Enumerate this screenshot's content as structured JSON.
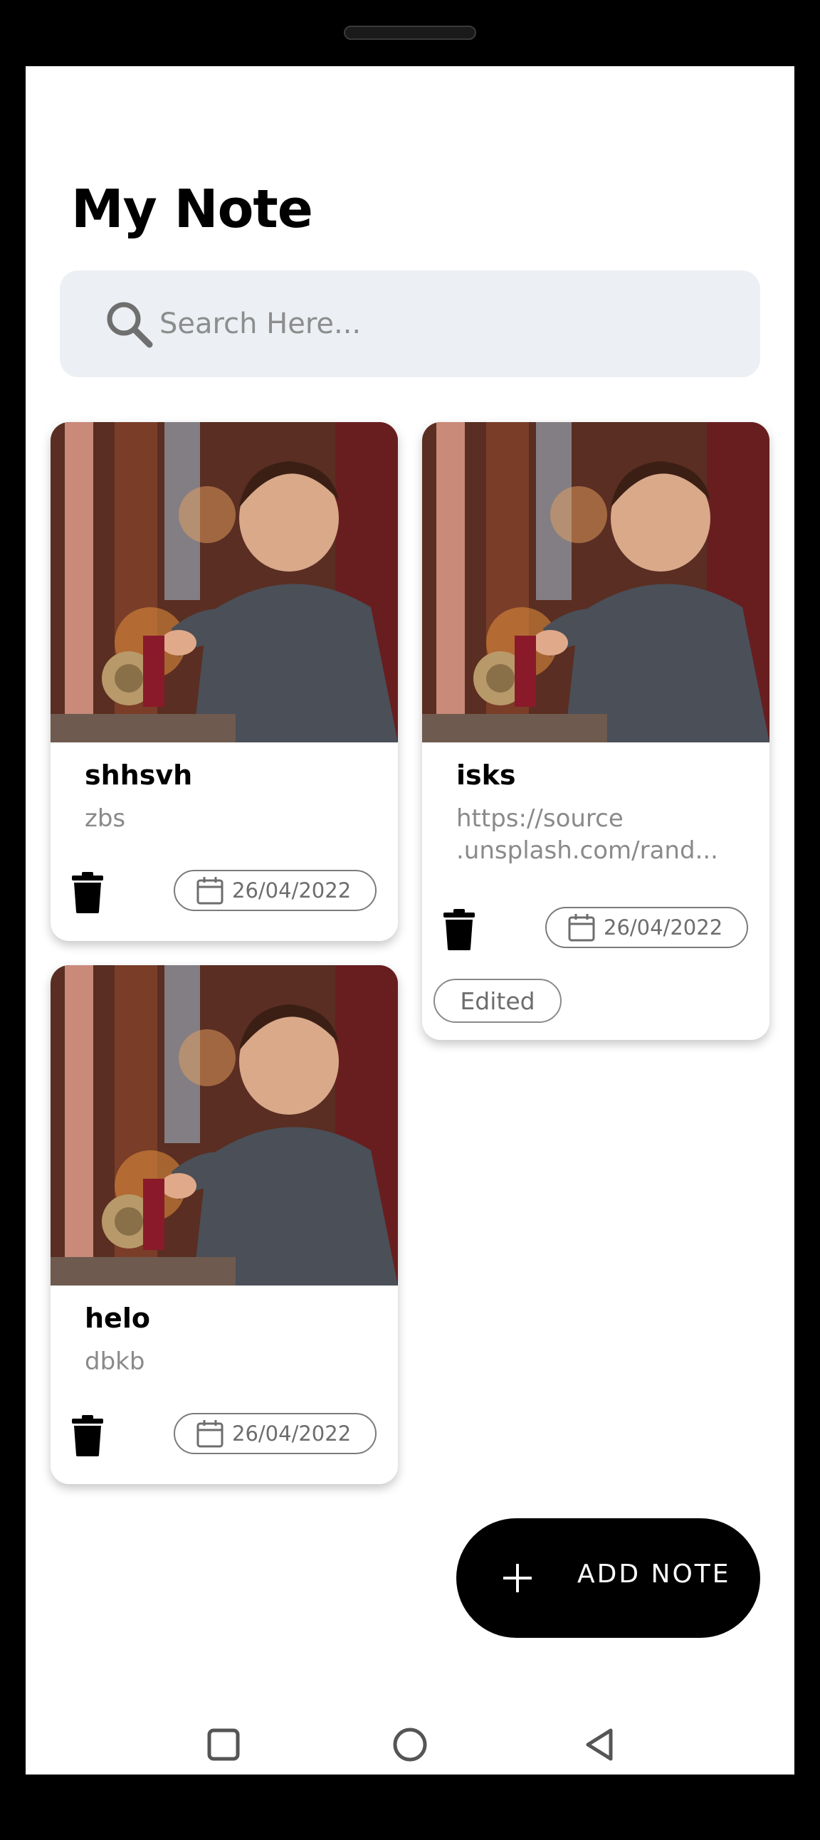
{
  "header": {
    "title": "My Note"
  },
  "search": {
    "placeholder": "Search Here..."
  },
  "notes": [
    {
      "title": "shhsvh",
      "body": "zbs",
      "date": "26/04/2022",
      "edited": false
    },
    {
      "title": "isks",
      "body": "https://source\n.unsplash.com/rand...",
      "date": "26/04/2022",
      "edited": true,
      "edited_label": "Edited"
    },
    {
      "title": "helo",
      "body": "dbkb",
      "date": "26/04/2022",
      "edited": false
    }
  ],
  "fab": {
    "label": "ADD NOTE",
    "icon": "plus-icon"
  },
  "icons": {
    "search": "search-icon",
    "delete": "trash-icon",
    "date": "calendar-icon",
    "nav_recents": "square-icon",
    "nav_home": "circle-icon",
    "nav_back": "triangle-back-icon"
  },
  "colors": {
    "accent": "#000000",
    "search_bg": "#eceff3",
    "muted_text": "#8a8a8a"
  }
}
